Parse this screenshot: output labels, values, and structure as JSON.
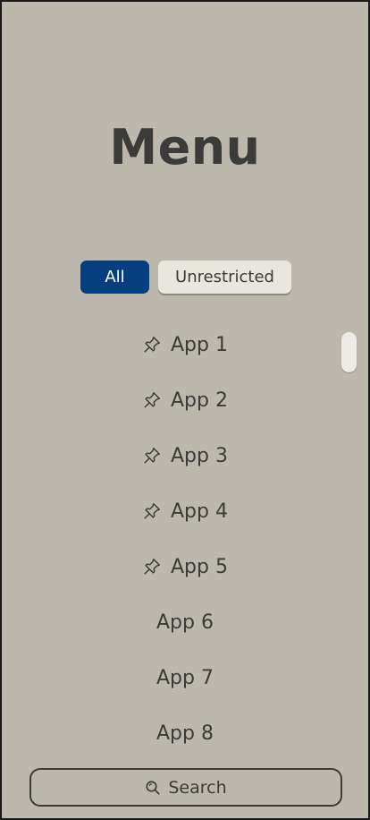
{
  "header": {
    "title": "Menu"
  },
  "filters": {
    "all_label": "All",
    "unrestricted_label": "Unrestricted"
  },
  "colors": {
    "background": "#bcb8ad",
    "accent": "#063f80",
    "chip_inactive": "#e8e6df",
    "text": "#3b3b39"
  },
  "apps": [
    {
      "label": "App 1",
      "pinned": true,
      "icon": "pin-icon"
    },
    {
      "label": "App 2",
      "pinned": true,
      "icon": "pin-icon"
    },
    {
      "label": "App 3",
      "pinned": true,
      "icon": "pin-icon"
    },
    {
      "label": "App 4",
      "pinned": true,
      "icon": "pin-icon"
    },
    {
      "label": "App 5",
      "pinned": true,
      "icon": "pin-icon"
    },
    {
      "label": "App 6",
      "pinned": false
    },
    {
      "label": "App 7",
      "pinned": false
    },
    {
      "label": "App 8",
      "pinned": false
    }
  ],
  "search": {
    "label": "Search",
    "icon": "search-icon"
  }
}
